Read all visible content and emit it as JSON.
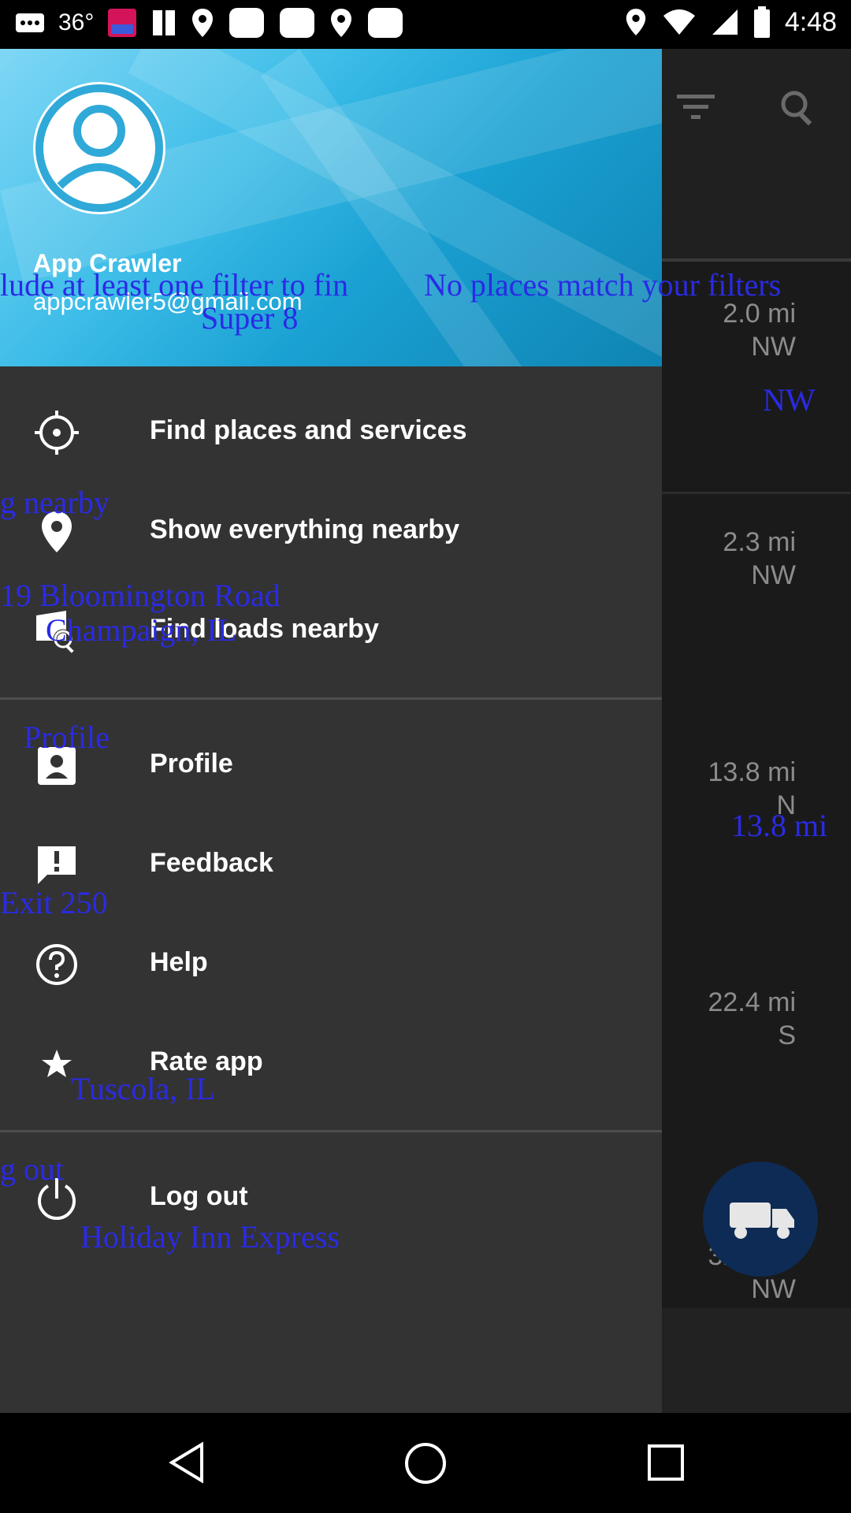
{
  "status_bar": {
    "temperature": "36°",
    "time": "4:48",
    "left_icons": [
      "message-icon",
      "bubble-icon",
      "pop-app-icon",
      "flash-icon",
      "location-icon",
      "rounded-square-icon",
      "rounded-square-icon",
      "location-icon",
      "rounded-square-icon"
    ],
    "right_icons": [
      "location-icon",
      "wifi-icon",
      "signal-icon",
      "battery-icon"
    ]
  },
  "background_app": {
    "toolbar_icons": [
      "filter-icon",
      "search-icon"
    ],
    "results": [
      {
        "distance": "2.0 mi",
        "direction": "NW"
      },
      {
        "distance": "2.3 mi",
        "direction": "NW"
      },
      {
        "distance": "13.8 mi",
        "direction": "N"
      },
      {
        "distance": "22.4 mi",
        "direction": "S"
      },
      {
        "distance": "32.4 mi",
        "direction": "NW"
      }
    ]
  },
  "drawer": {
    "header": {
      "user_name": "App Crawler",
      "user_email": "appcrawler5@gmail.com"
    },
    "menu": [
      {
        "label": "Find places and services",
        "icon": "crosshair-icon"
      },
      {
        "label": "Show everything nearby",
        "icon": "location-pin-icon"
      },
      {
        "label": "Find loads nearby",
        "icon": "load-search-icon"
      },
      {
        "label": "Profile",
        "icon": "profile-card-icon"
      },
      {
        "label": "Feedback",
        "icon": "feedback-icon"
      },
      {
        "label": "Help",
        "icon": "help-icon"
      },
      {
        "label": "Rate app",
        "icon": "star-icon"
      },
      {
        "label": "Log out",
        "icon": "power-icon"
      }
    ]
  },
  "overlay_texts": {
    "filter_hint": "lude at least one filter to fin",
    "no_match": "No places match your filters",
    "super8": "Super 8",
    "nw": "NW",
    "nearby": "g nearby",
    "address": "19 Bloomington Road",
    "city": "Champaign, IL",
    "profile": "Profile",
    "distance": "13.8 mi",
    "exit": "Exit 250",
    "tuscola": "Tuscola, IL",
    "logout": "g out",
    "holiday": "Holiday Inn Express"
  },
  "colors": {
    "drawer_bg": "#333333",
    "header_gradient_start": "#7fd7f5",
    "header_gradient_end": "#0f84b3",
    "overlay_text": "#2a2ae6",
    "fab": "#0e2b55"
  }
}
